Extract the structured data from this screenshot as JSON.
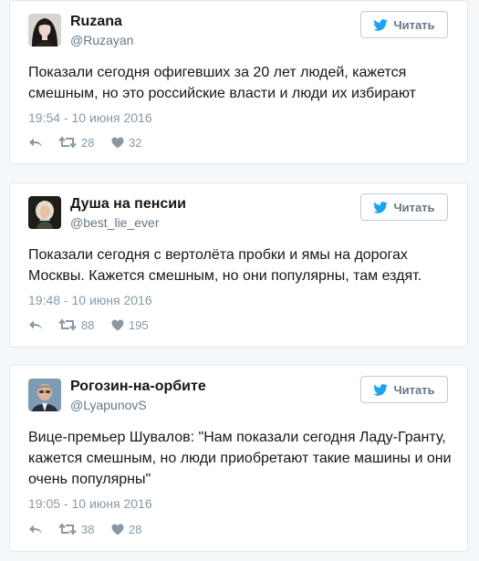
{
  "tweets": [
    {
      "name": "Ruzana",
      "handle": "@Ruzayan",
      "follow_label": "Читать",
      "text": "Показали сегодня офигевших за 20 лет людей, кажется смешным, но это российские власти и люди их избирают",
      "timestamp": "19:54 - 10 июня 2016",
      "retweets": "28",
      "likes": "32"
    },
    {
      "name": "Душа на пенсии",
      "handle": "@best_lie_ever",
      "follow_label": "Читать",
      "text": "Показали сегодня с вертолёта пробки и ямы на дорогах Москвы. Кажется смешным, но они популярны, там ездят.",
      "timestamp": "19:48 - 10 июня 2016",
      "retweets": "88",
      "likes": "195"
    },
    {
      "name": "Рогозин-на-орбите",
      "handle": "@LyapunovS",
      "follow_label": "Читать",
      "text": "Вице-премьер Шувалов: \"Нам показали сегодня Ладу-Гранту, кажется смешным, но люди приобретают такие машины и они очень популярны\"",
      "timestamp": "19:05 - 10 июня 2016",
      "retweets": "38",
      "likes": "28"
    }
  ],
  "icons": {
    "follow": "twitter-bird-icon",
    "reply": "reply-icon",
    "retweet": "retweet-icon",
    "like": "heart-icon"
  },
  "colors": {
    "brand_blue": "#1da1f2",
    "muted": "#8899a6",
    "border": "#e1e8ed"
  }
}
